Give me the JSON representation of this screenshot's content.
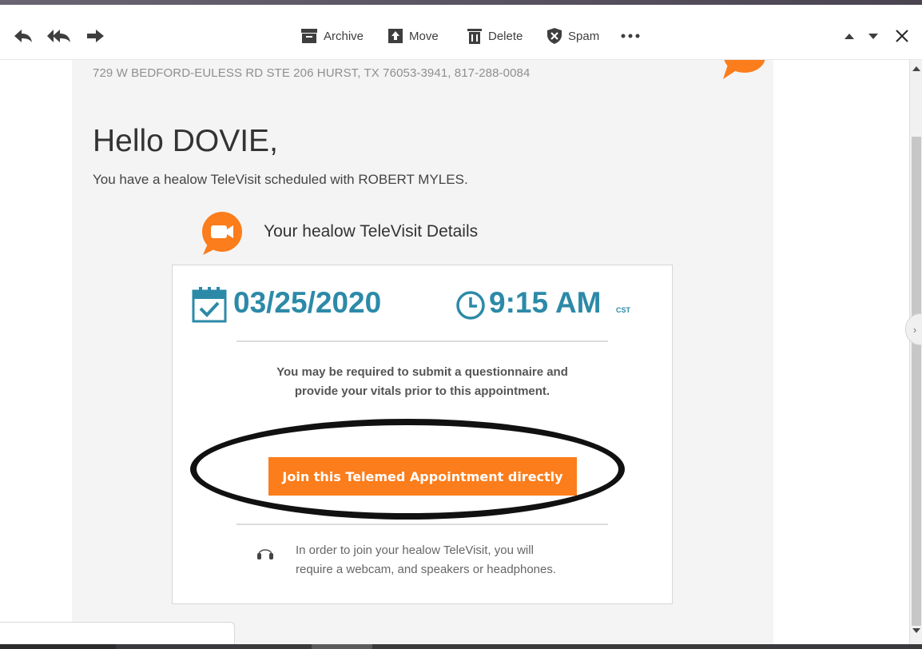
{
  "toolbar": {
    "actions": [
      {
        "label": "Archive",
        "icon": "archive-icon"
      },
      {
        "label": "Move",
        "icon": "move-icon"
      },
      {
        "label": "Delete",
        "icon": "trash-icon"
      },
      {
        "label": "Spam",
        "icon": "shield-icon"
      }
    ],
    "nav_icons": [
      "reply-icon",
      "reply-all-icon",
      "forward-icon"
    ],
    "more_icon": "more-horizontal-icon",
    "right_icons": [
      "up-arrow-icon",
      "down-arrow-icon",
      "close-icon"
    ]
  },
  "email": {
    "address_line": "729 W BEDFORD-EULESS RD STE 206 HURST, TX 76053-3941, 817-288-0084",
    "greeting": "Hello DOVIE,",
    "intro": "You have a healow TeleVisit scheduled with ROBERT MYLES.",
    "details_title": "Your healow TeleVisit Details",
    "date": "03/25/2020",
    "time": "9:15 AM",
    "timezone": "CST",
    "notice_line1": "You may be required to submit a questionnaire and",
    "notice_line2": "provide your vitals prior to this appointment.",
    "join_button": "Join this Telemed Appointment directly",
    "requirement_line1": "In order to join your healow TeleVisit, you will",
    "requirement_line2": "require a webcam, and speakers or headphones."
  },
  "colors": {
    "accent_orange": "#fb7d1b",
    "date_blue": "#2c8aa8",
    "annotation_ellipse": "#111111"
  }
}
